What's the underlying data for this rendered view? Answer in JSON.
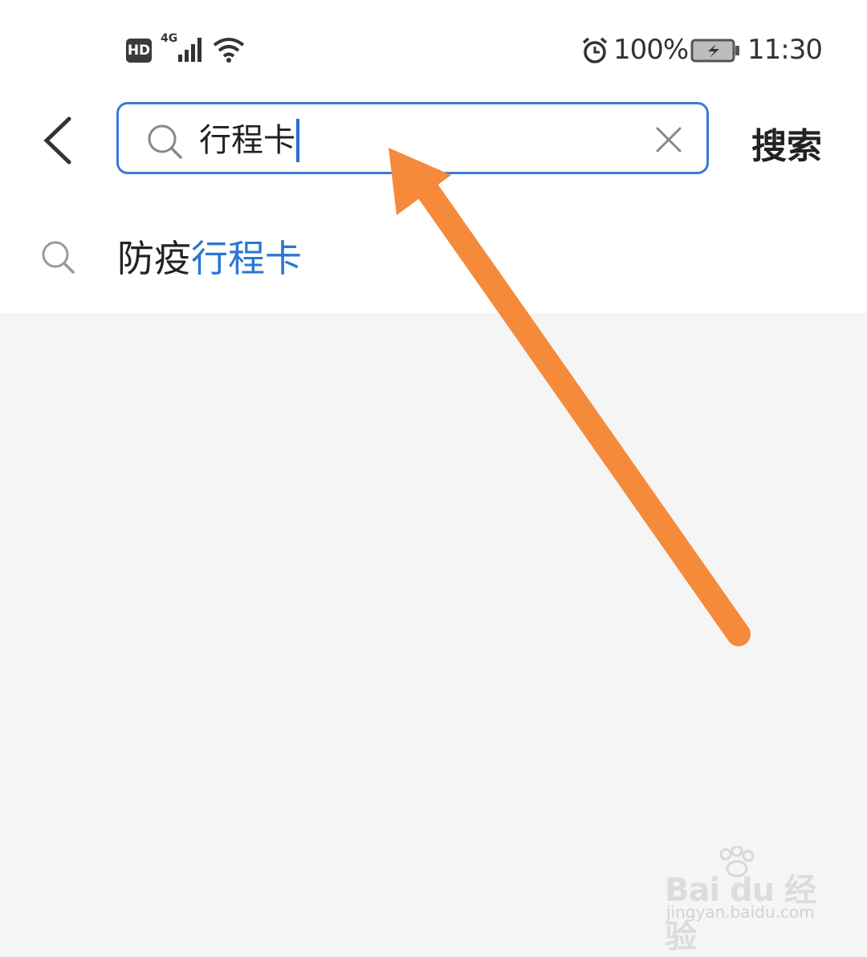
{
  "status_bar": {
    "hd_badge": "HD",
    "network": "4G",
    "battery_percent": "100%",
    "time": "11:30",
    "icons": [
      "hd-icon",
      "signal-icon",
      "wifi-icon",
      "alarm-icon",
      "battery-charging-icon"
    ]
  },
  "header": {
    "back_icon": "chevron-left-icon",
    "search": {
      "value": "行程卡",
      "search_icon": "search-icon",
      "clear_icon": "close-icon"
    },
    "search_button_label": "搜索"
  },
  "suggestions": [
    {
      "prefix": "防疫",
      "highlight": "行程卡",
      "icon": "search-icon"
    }
  ],
  "colors": {
    "accent": "#3a7bd5",
    "highlight": "#2b77d2",
    "annotation_arrow": "#f58a3a",
    "background": "#f5f5f5"
  },
  "watermark": {
    "brand": "Bai du 经验",
    "url": "jingyan.baidu.com"
  }
}
